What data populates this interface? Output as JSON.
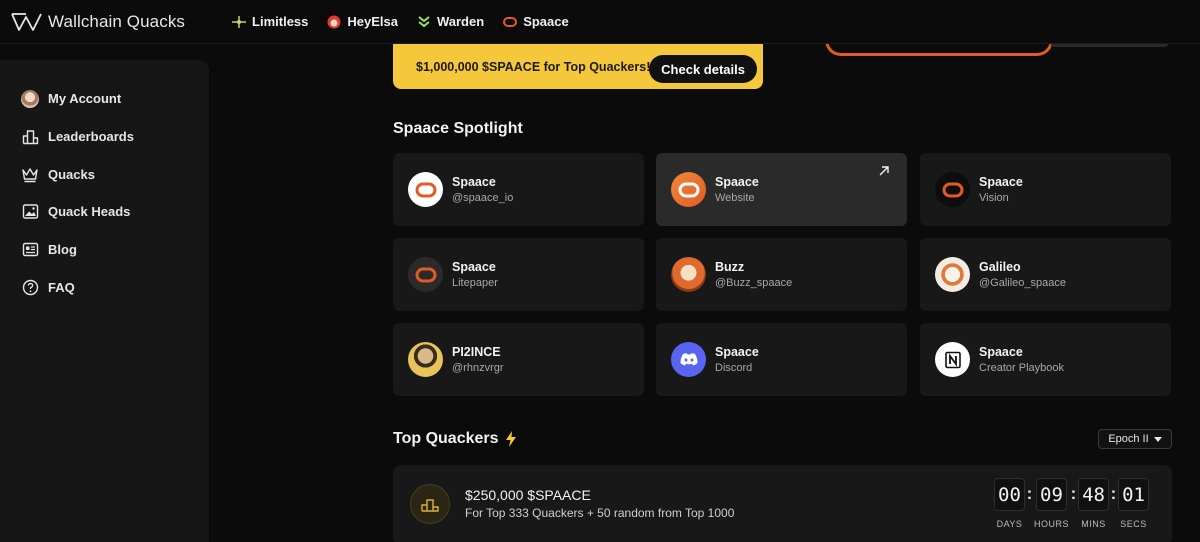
{
  "brand": {
    "name": "Wallchain Quacks"
  },
  "partners": [
    {
      "name": "Limitless"
    },
    {
      "name": "HeyElsa"
    },
    {
      "name": "Warden"
    },
    {
      "name": "Spaace"
    }
  ],
  "sidebar": {
    "items": [
      {
        "label": "My Account"
      },
      {
        "label": "Leaderboards"
      },
      {
        "label": "Quacks"
      },
      {
        "label": "Quack Heads"
      },
      {
        "label": "Blog"
      },
      {
        "label": "FAQ"
      }
    ]
  },
  "banner": {
    "text": "$1,000,000 $SPAACE for Top Quackers!",
    "button": "Check details"
  },
  "spotlight": {
    "title": "Spaace Spotlight",
    "cards": [
      {
        "name": "Spaace",
        "sub": "@spaace_io"
      },
      {
        "name": "Spaace",
        "sub": "Website"
      },
      {
        "name": "Spaace",
        "sub": "Vision"
      },
      {
        "name": "Spaace",
        "sub": "Litepaper"
      },
      {
        "name": "Buzz",
        "sub": "@Buzz_spaace"
      },
      {
        "name": "Galileo",
        "sub": "@Galileo_spaace"
      },
      {
        "name": "PI2INCE",
        "sub": "@rhnzvrgr"
      },
      {
        "name": "Spaace",
        "sub": "Discord"
      },
      {
        "name": "Spaace",
        "sub": "Creator Playbook"
      }
    ]
  },
  "top_quackers": {
    "title": "Top Quackers",
    "epoch": "Epoch II",
    "prize_title": "$250,000 $SPAACE",
    "prize_desc": "For Top 333 Quackers + 50 random from Top 1000",
    "timer": {
      "days": "00",
      "hours": "09",
      "mins": "48",
      "secs": "01",
      "labels": {
        "days": "DAYS",
        "hours": "HOURS",
        "mins": "MINS",
        "secs": "SECS"
      }
    }
  },
  "colors": {
    "accent": "#f5c73a",
    "spaace": "#e25a24",
    "discord": "#5865f2"
  }
}
